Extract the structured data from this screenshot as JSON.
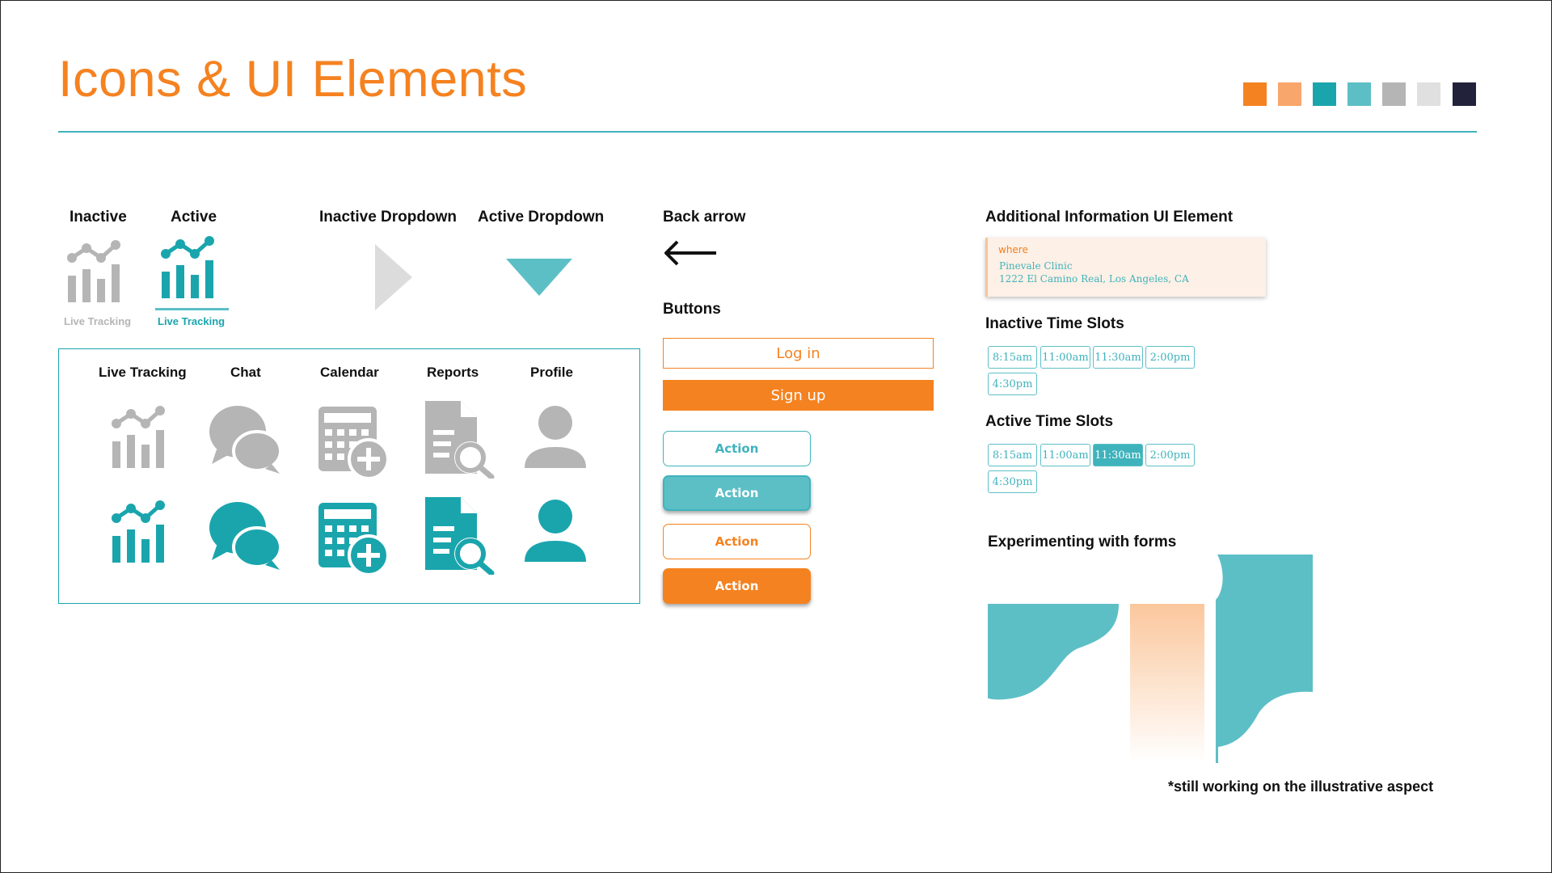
{
  "title": "Icons & UI Elements",
  "palette": [
    "#f58220",
    "#f9a66c",
    "#1aa5ad",
    "#5dbfc6",
    "#b5b5b5",
    "#e0e0e0",
    "#22223b"
  ],
  "colors": {
    "accent": "#f58220",
    "teal": "#1aa5ad",
    "gray_icon": "#b5b5b5"
  },
  "states": {
    "inactive_label": "Inactive",
    "active_label": "Active",
    "inactive_caption": "Live Tracking",
    "active_caption": "Live Tracking",
    "inactive_dropdown_label": "Inactive Dropdown",
    "active_dropdown_label": "Active Dropdown"
  },
  "icon_grid": {
    "headers": [
      "Live Tracking",
      "Chat",
      "Calendar",
      "Reports",
      "Profile"
    ],
    "icons": [
      "live-tracking-icon",
      "chat-icon",
      "calendar-add-icon",
      "report-search-icon",
      "profile-icon"
    ]
  },
  "back_arrow_label": "Back arrow",
  "buttons": {
    "heading": "Buttons",
    "login": "Log in",
    "signup": "Sign up",
    "action_labels": [
      "Action",
      "Action",
      "Action",
      "Action"
    ]
  },
  "additional_info": {
    "heading": "Additional Information UI Element",
    "where": "where",
    "clinic": "Pinevale Clinic",
    "address": "1222 El Camino Real, Los Angeles, CA"
  },
  "inactive_slots": {
    "heading": "Inactive Time Slots",
    "times": [
      "8:15am",
      "11:00am",
      "11:30am",
      "2:00pm",
      "4:30pm"
    ]
  },
  "active_slots": {
    "heading": "Active Time Slots",
    "times": [
      "8:15am",
      "11:00am",
      "11:30am",
      "2:00pm",
      "4:30pm"
    ],
    "selected": "11:30am"
  },
  "forms": {
    "heading": "Experimenting with forms",
    "footnote": "*still working on the illustrative aspect"
  }
}
